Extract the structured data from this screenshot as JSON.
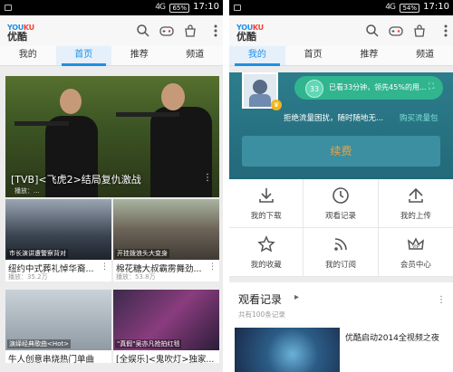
{
  "status_bar": {
    "left": {
      "signal": "4G",
      "battery": "65%",
      "time": "17:10"
    },
    "right": {
      "signal": "4G",
      "battery": "54%",
      "time": "17:10"
    }
  },
  "logo": {
    "en_prefix": "YOU",
    "en_suffix": "KU",
    "cn": "优酷"
  },
  "left_tabs": [
    "我的",
    "首页",
    "推荐",
    "频道"
  ],
  "right_tabs": [
    "我的",
    "首页",
    "推荐",
    "频道"
  ],
  "hero": {
    "title": "[TVB]<飞虎2>结局复仇激战",
    "subtitle": "播放：..."
  },
  "left_cards": [
    {
      "caption": "市长演讲遭警察背对",
      "title": "纽约中式葬礼悼华裔...",
      "meta": "播放：35.2万"
    },
    {
      "caption": "开挂拨浪头大变身",
      "title": "棉花糖大叔霸雳舞劲...",
      "meta": "播放：53.8万"
    },
    {
      "caption": "演绎经典歌曲<Hot>",
      "title": "牛人创意串烧热门单曲",
      "meta": ""
    },
    {
      "caption": "\"真假\"吴亦凡抢拍红毯",
      "title": "[全娱乐]<鬼吹灯>独家...",
      "meta": ""
    }
  ],
  "profile": {
    "level": "33",
    "level_text": "已看33分钟，领先45%的用...",
    "notice": "拒绝流量困扰，随时随地无...",
    "notice_link": "购买流量包",
    "renew_label": "续费"
  },
  "menu": [
    {
      "label": "我的下载",
      "icon": "download-icon"
    },
    {
      "label": "观看记录",
      "icon": "clock-icon"
    },
    {
      "label": "我的上传",
      "icon": "upload-icon"
    },
    {
      "label": "我的收藏",
      "icon": "star-icon"
    },
    {
      "label": "我的订阅",
      "icon": "rss-icon"
    },
    {
      "label": "会员中心",
      "icon": "crown-icon"
    }
  ],
  "history": {
    "title": "观看记录",
    "subtitle": "共有100条记录",
    "item_title": "优酷启动2014全视频之夜"
  },
  "colors": {
    "accent": "#1f8fe5",
    "profile_bg": "#2c7d8c",
    "renew_text": "#f4a03c"
  }
}
